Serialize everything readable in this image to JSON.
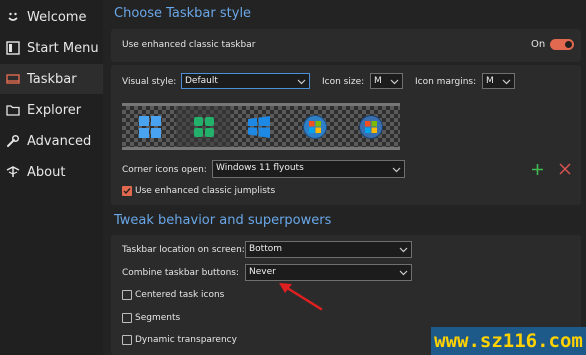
{
  "sidebar": {
    "items": [
      {
        "label": "Welcome",
        "icon": "smile-icon"
      },
      {
        "label": "Start Menu",
        "icon": "start-menu-icon"
      },
      {
        "label": "Taskbar",
        "icon": "taskbar-icon",
        "active": true
      },
      {
        "label": "Explorer",
        "icon": "folder-icon"
      },
      {
        "label": "Advanced",
        "icon": "wrench-icon"
      },
      {
        "label": "About",
        "icon": "about-icon"
      }
    ]
  },
  "taskbar_style": {
    "title": "Choose Taskbar style",
    "enhanced_label": "Use enhanced classic taskbar",
    "toggle_state": "On",
    "visual_style_label": "Visual style:",
    "visual_style_value": "Default",
    "icon_size_label": "Icon size:",
    "icon_size_value": "M",
    "icon_margins_label": "Icon margins:",
    "icon_margins_value": "M",
    "corner_icons_label": "Corner icons open:",
    "corner_icons_value": "Windows 11 flyouts",
    "jumplists_label": "Use enhanced classic jumplists",
    "jumplists_checked": true
  },
  "tweaks": {
    "title": "Tweak behavior and superpowers",
    "location_label": "Taskbar location on screen:",
    "location_value": "Bottom",
    "combine_label": "Combine taskbar buttons:",
    "combine_value": "Never",
    "options": [
      {
        "label": "Centered task icons",
        "checked": false
      },
      {
        "label": "Segments",
        "checked": false
      },
      {
        "label": "Dynamic transparency",
        "checked": false
      }
    ]
  },
  "colors": {
    "accent": "#e0694f",
    "section_title": "#69a7e8",
    "add": "#3fb950",
    "remove": "#d9534f",
    "arrow": "#e02020"
  },
  "watermark": "www.sz116.com"
}
